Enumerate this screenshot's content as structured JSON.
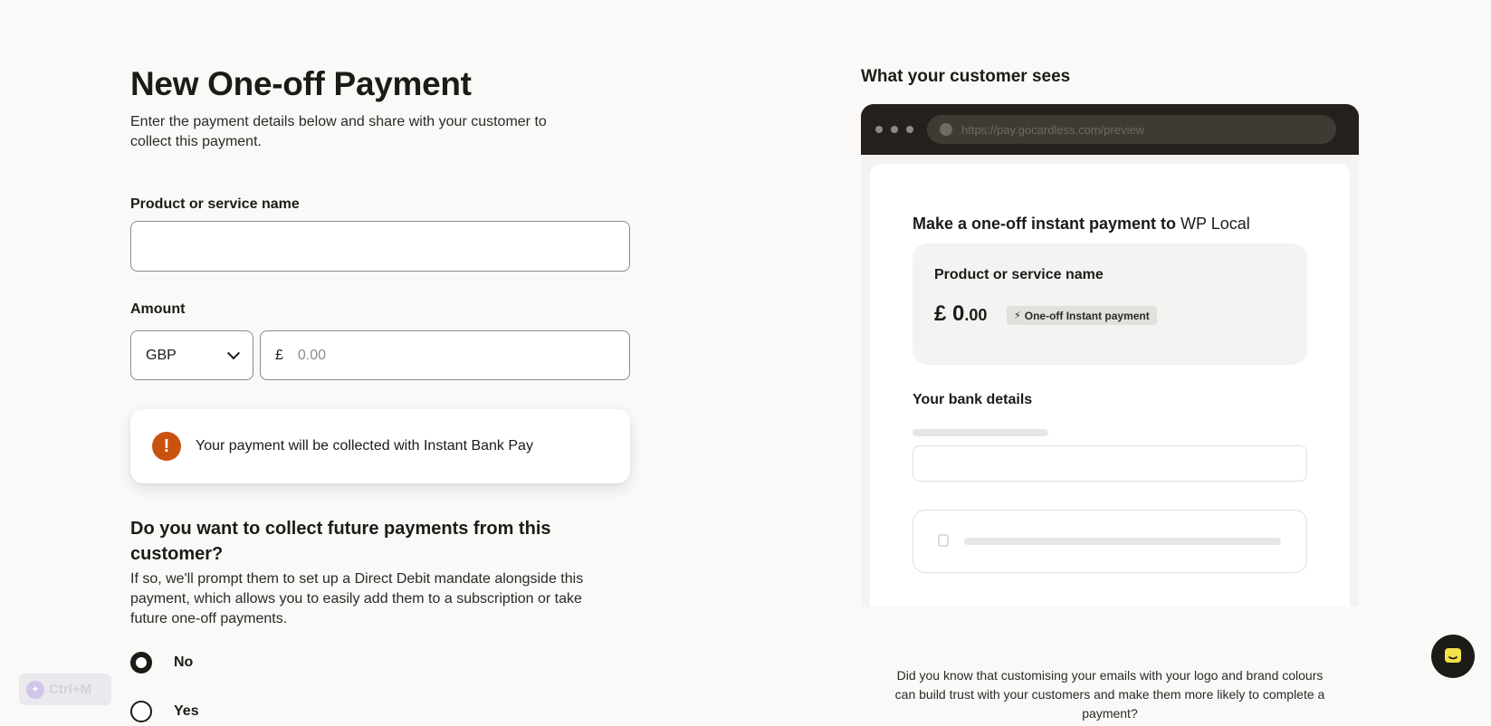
{
  "page": {
    "title": "New One-off Payment",
    "subtitle": "Enter the payment details below and share with your customer to collect this payment."
  },
  "form": {
    "product_label": "Product or service name",
    "product_value": "",
    "amount_label": "Amount",
    "currency": "GBP",
    "currency_symbol": "£",
    "amount_placeholder": "0.00",
    "notice": "Your payment will be collected with Instant Bank Pay",
    "future_question": "Do you want to collect future payments from this customer?",
    "future_description": "If so, we'll prompt them to set up a Direct Debit mandate alongside this payment, which allows you to easily add them to a subscription or take future one-off payments.",
    "options": [
      {
        "label": "No",
        "selected": true
      },
      {
        "label": "Yes",
        "selected": false
      }
    ]
  },
  "shortcut": {
    "label": "Ctrl+M"
  },
  "preview": {
    "title": "What your customer sees",
    "url": "https://pay.gocardless.com/preview",
    "heading_prefix": "Make a one-off instant payment to ",
    "merchant": "WP Local",
    "product_name": "Product or service name",
    "amount_major": "£ 0",
    "amount_minor": ".00",
    "badge": "One-off Instant payment",
    "bank_label": "Your bank details"
  },
  "tip": "Did you know that customising your emails with your logo and brand colours can build trust with your customers and make them more likely to complete a payment?",
  "colors": {
    "warning": "#c9530e",
    "browser_chrome": "#25201b",
    "background": "#faf9f7"
  }
}
